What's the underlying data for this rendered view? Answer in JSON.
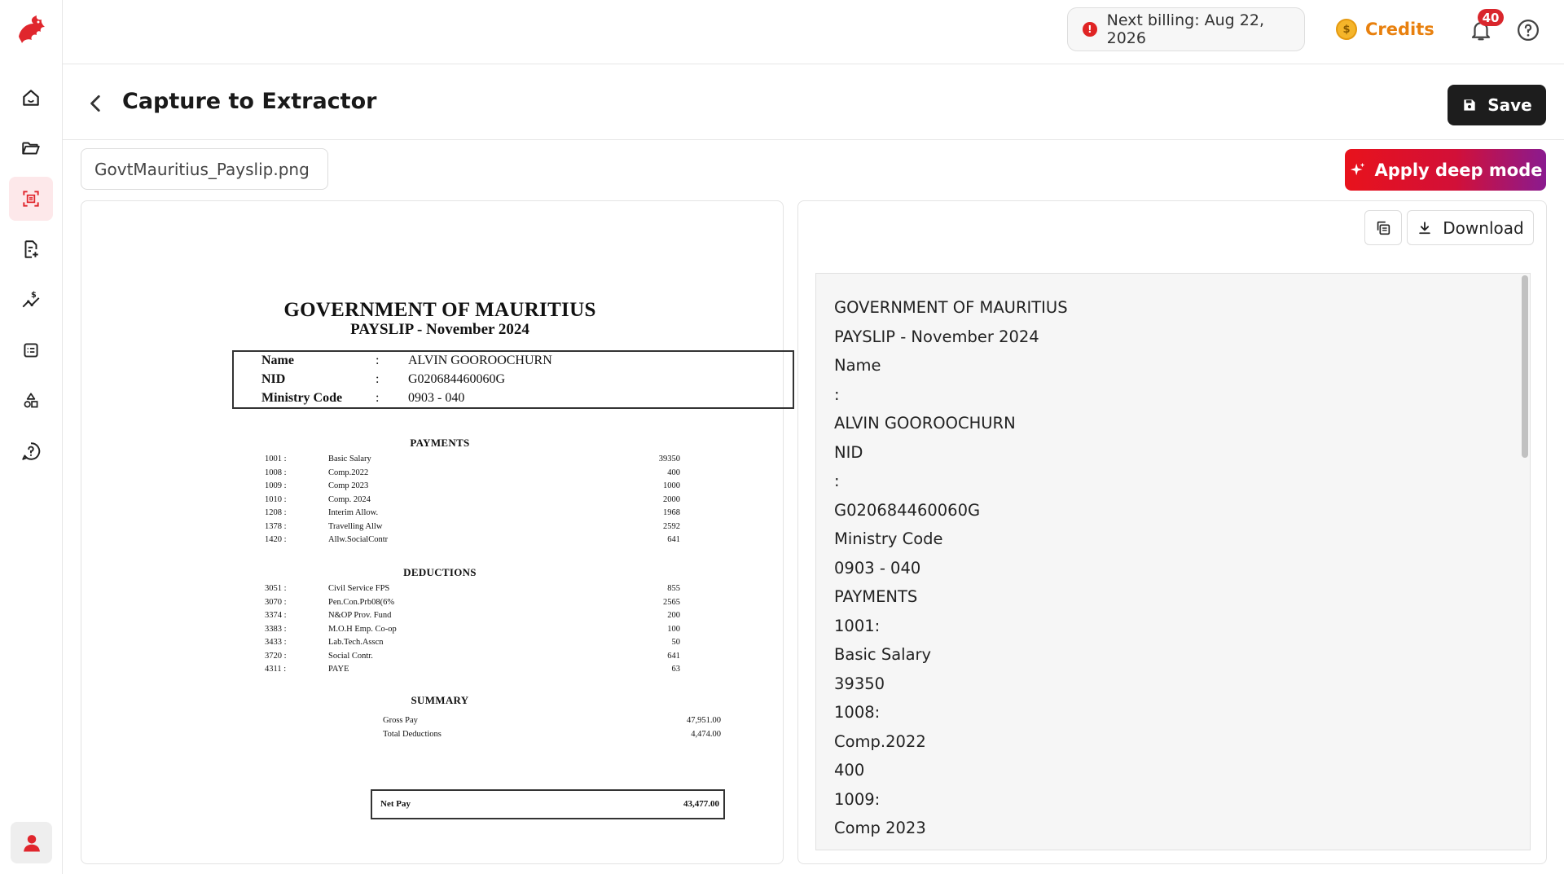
{
  "sidebar": {
    "logo": "dragon-logo",
    "items": [
      {
        "icon": "home-icon",
        "active": false
      },
      {
        "icon": "folder-icon",
        "active": false
      },
      {
        "icon": "scan-icon",
        "active": true
      },
      {
        "icon": "document-add-icon",
        "active": false
      },
      {
        "icon": "dollar-flow-icon",
        "active": false
      },
      {
        "icon": "list-box-icon",
        "active": false
      },
      {
        "icon": "shapes-icon",
        "active": false
      },
      {
        "icon": "help-icon",
        "active": false
      }
    ]
  },
  "header": {
    "billing_label": "Next billing: Aug 22, 2026",
    "credits_label": "Credits",
    "coin_symbol": "$",
    "notifications_count": "40"
  },
  "page": {
    "title": "Capture to Extractor",
    "save_label": "Save",
    "file_name": "GovtMauritius_Payslip.png",
    "deep_mode_label": "Apply deep mode",
    "download_label": "Download"
  },
  "payslip": {
    "title": "GOVERNMENT OF MAURITIUS",
    "subtitle": "PAYSLIP - November 2024",
    "id_rows": [
      {
        "key": "Name",
        "sep": ":",
        "value": "ALVIN GOOROOCHURN"
      },
      {
        "key": "NID",
        "sep": ":",
        "value": "G020684460060G"
      },
      {
        "key": "Ministry Code",
        "sep": ":",
        "value": "0903 - 040"
      }
    ],
    "payments_title": "PAYMENTS",
    "payments": [
      {
        "code": "1001 :",
        "desc": "Basic Salary",
        "amt": "39350"
      },
      {
        "code": "1008 :",
        "desc": "Comp.2022",
        "amt": "400"
      },
      {
        "code": "1009 :",
        "desc": "Comp 2023",
        "amt": "1000"
      },
      {
        "code": "1010 :",
        "desc": "Comp. 2024",
        "amt": "2000"
      },
      {
        "code": "1208 :",
        "desc": "Interim Allow.",
        "amt": "1968"
      },
      {
        "code": "1378 :",
        "desc": "Travelling Allw",
        "amt": "2592"
      },
      {
        "code": "1420 :",
        "desc": "Allw.SocialContr",
        "amt": "641"
      }
    ],
    "deductions_title": "DEDUCTIONS",
    "deductions": [
      {
        "code": "3051 :",
        "desc": "Civil Service FPS",
        "amt": "855"
      },
      {
        "code": "3070 :",
        "desc": "Pen.Con.Prb08(6%",
        "amt": "2565"
      },
      {
        "code": "3374 :",
        "desc": "N&OP Prov. Fund",
        "amt": "200"
      },
      {
        "code": "3383 :",
        "desc": "M.O.H Emp. Co-op",
        "amt": "100"
      },
      {
        "code": "3433 :",
        "desc": "Lab.Tech.Asscn",
        "amt": "50"
      },
      {
        "code": "3720 :",
        "desc": "Social Contr.",
        "amt": "641"
      },
      {
        "code": "4311 :",
        "desc": "PAYE",
        "amt": "63"
      }
    ],
    "summary_title": "SUMMARY",
    "summary": [
      {
        "label": "Gross Pay",
        "amt": "47,951.00"
      },
      {
        "label": "Total Deductions",
        "amt": "4,474.00"
      }
    ],
    "net_pay_label": "Net Pay",
    "net_pay_amt": "43,477.00"
  },
  "extracted_text": [
    "GOVERNMENT OF MAURITIUS",
    "PAYSLIP - November 2024",
    "Name",
    ":",
    "ALVIN GOOROOCHURN",
    "NID",
    ":",
    "G020684460060G",
    "Ministry Code",
    "0903 - 040",
    "PAYMENTS",
    "1001:",
    "Basic Salary",
    "39350",
    "1008:",
    "Comp.2022",
    "400",
    "1009:",
    "Comp 2023"
  ]
}
